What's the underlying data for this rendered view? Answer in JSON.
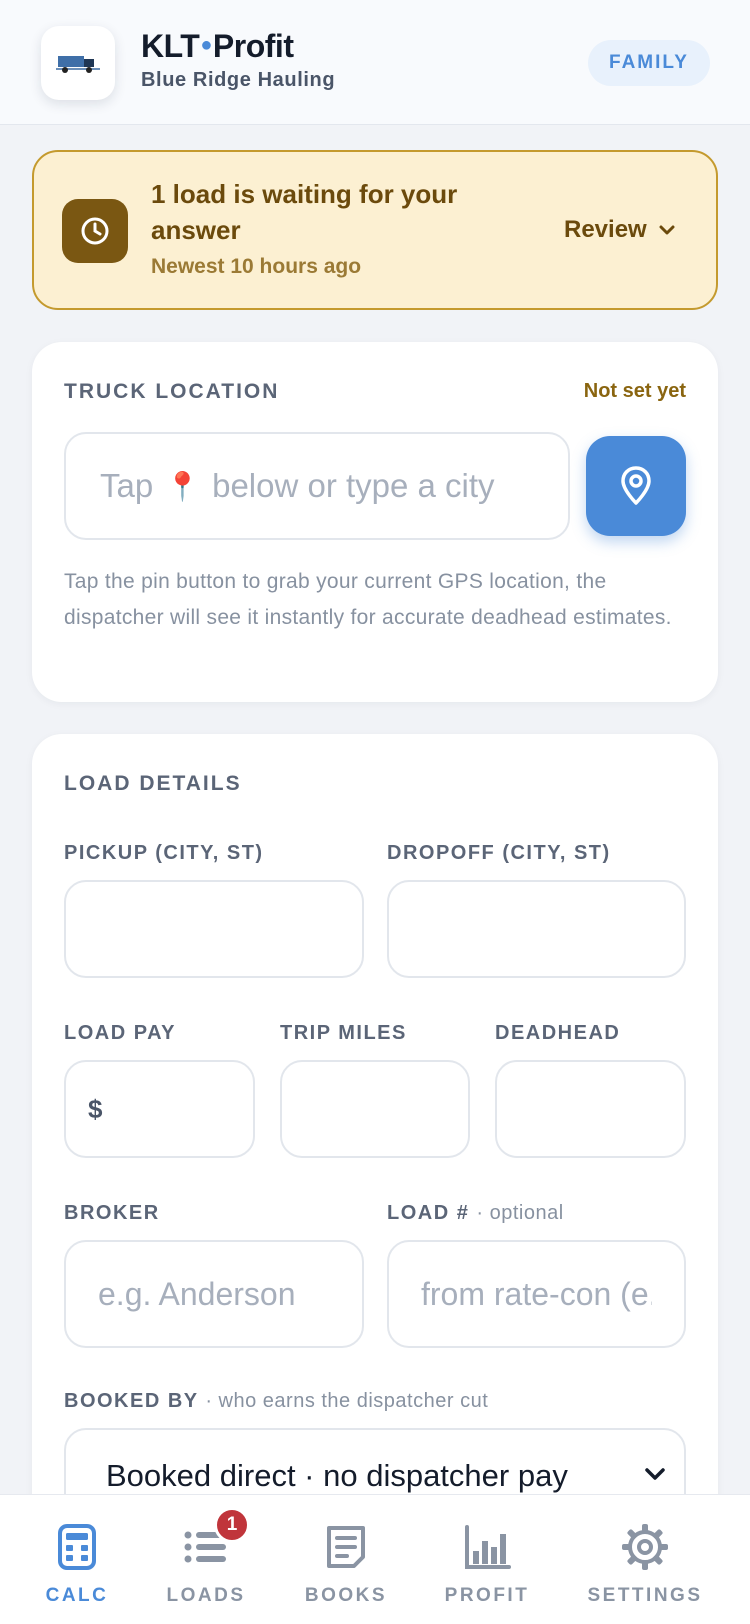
{
  "header": {
    "app_name_part1": "KLT",
    "app_name_part2": "Profit",
    "company": "Blue Ridge Hauling",
    "plan_badge": "FAMILY"
  },
  "alert": {
    "title": "1 load is waiting for your answer",
    "subtitle": "Newest 10 hours ago",
    "action_label": "Review"
  },
  "truck_location": {
    "title": "TRUCK LOCATION",
    "status": "Not set yet",
    "placeholder_before": "Tap",
    "placeholder_pin": "📍",
    "placeholder_after": "below or type a city",
    "hint": "Tap the pin button to grab your current GPS location, the dispatcher will see it instantly for accurate deadhead estimates."
  },
  "load_details": {
    "title": "LOAD DETAILS",
    "pickup_label": "PICKUP (CITY, ST)",
    "pickup_value": "",
    "dropoff_label": "DROPOFF (CITY, ST)",
    "dropoff_value": "",
    "load_pay_label": "LOAD PAY",
    "currency_symbol": "$",
    "load_pay_value": "",
    "trip_miles_label": "TRIP MILES",
    "trip_miles_value": "",
    "deadhead_label": "DEADHEAD",
    "deadhead_value": "",
    "broker_label": "BROKER",
    "broker_placeholder": "e.g. Anderson",
    "load_number_label": "LOAD #",
    "load_number_optional": "· optional",
    "load_number_placeholder": "from rate-con (e.g.",
    "booked_by_label": "BOOKED BY",
    "booked_by_hint": "· who earns the dispatcher cut",
    "booked_by_value": "Booked direct · no dispatcher pay"
  },
  "nav": {
    "items": [
      {
        "label": "CALC",
        "icon": "calculator-icon",
        "active": true
      },
      {
        "label": "LOADS",
        "icon": "list-icon",
        "badge": "1"
      },
      {
        "label": "BOOKS",
        "icon": "document-icon"
      },
      {
        "label": "PROFIT",
        "icon": "bar-chart-icon"
      },
      {
        "label": "SETTINGS",
        "icon": "gear-icon"
      }
    ]
  },
  "colors": {
    "accent": "#4a8ad8",
    "alert_bg": "#fcf0d2",
    "alert_border": "#c49a2e",
    "alert_icon_bg": "#7a5712",
    "badge_red": "#c0353b"
  }
}
